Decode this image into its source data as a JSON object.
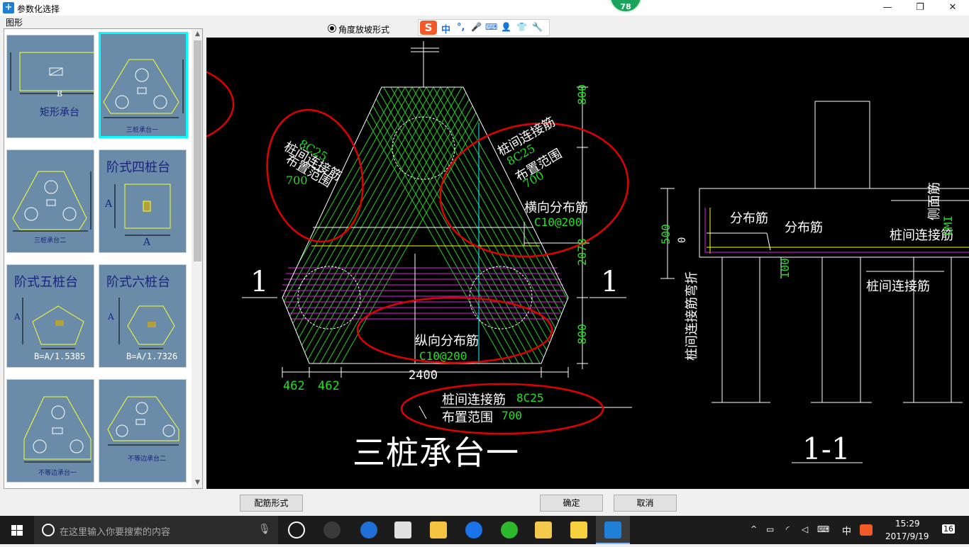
{
  "window": {
    "title": "参数化选择",
    "badge": "78",
    "group_label": "图形"
  },
  "thumbnails": [
    {
      "name": "矩形承台",
      "label": "矩形承台",
      "dim": "B"
    },
    {
      "name": "三桩承台一",
      "label": "三桩承台一",
      "selected": true
    },
    {
      "name": "三桩承台二",
      "label": "三桩承台二"
    },
    {
      "name": "阶式四桩台",
      "label": "阶式四桩台",
      "dim": "A"
    },
    {
      "name": "阶式五桩台",
      "label": "阶式五桩台",
      "formula": "B=A/1.5385",
      "dim": "A"
    },
    {
      "name": "阶式六桩台",
      "label": "阶式六桩台",
      "formula": "B=A/1.7326",
      "dim": "A"
    },
    {
      "name": "不等边承台一",
      "label": "不等边承台一"
    },
    {
      "name": "不等边承台二",
      "label": "不等边承台二"
    }
  ],
  "topbar": {
    "radio_label": "角度放坡形式",
    "ime_items": [
      "中",
      "°,",
      "🎤",
      "⌨",
      "👤",
      "👕",
      "🔧"
    ]
  },
  "drawing": {
    "main_title": "三桩承台一",
    "section_title": "1-1",
    "section_mark": "1",
    "labels": {
      "pile_link": "桩间连接筋",
      "pile_link_spec": "8C25",
      "layout_range": "布置范围",
      "range_value": "700",
      "horizontal_dist": "横向分布筋",
      "horizontal_spec": "C10@200",
      "vertical_dist": "纵向分布筋",
      "vertical_spec": "C10@200",
      "dist_rebar": "分布筋",
      "side_rebar": "侧面筋",
      "side_spec": "CMI",
      "link_bend": "桩间连接筋弯折"
    },
    "dims": {
      "top": "800",
      "mid": "2078",
      "bottom": "800",
      "width": "2400",
      "edge1": "462",
      "edge2": "462",
      "section_height": "500",
      "section_zero": "0",
      "section_100": "100"
    }
  },
  "buttons": {
    "rebar_form": "配筋形式",
    "ok": "确定",
    "cancel": "取消"
  },
  "taskbar": {
    "search_placeholder": "在这里输入你要搜索的内容",
    "time": "15:29",
    "date": "2017/9/19",
    "ime": "中",
    "notification_count": "16"
  },
  "colors": {
    "canvas_bg": "#000000",
    "green": "#00e000",
    "yellow": "#ffff00",
    "magenta": "#e020e0",
    "red_annotation": "#e00000",
    "selection": "#00ffff"
  }
}
